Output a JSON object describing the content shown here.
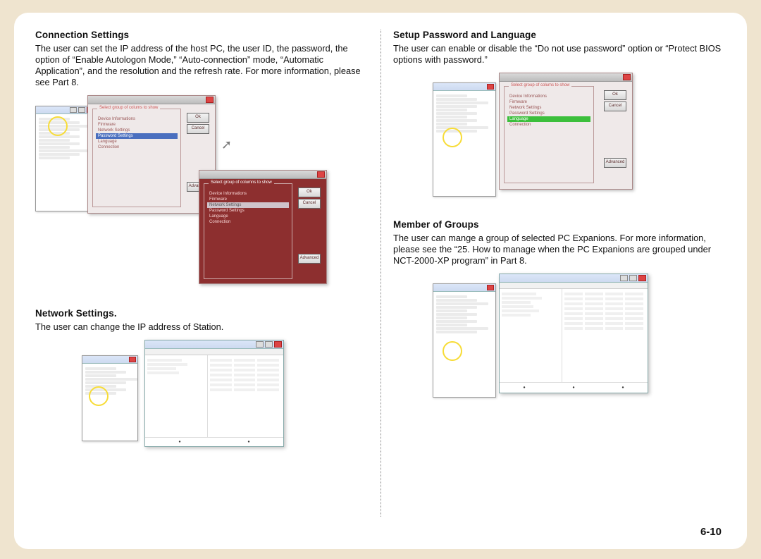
{
  "page_number": "6-10",
  "column_options": [
    "Device Informations",
    "Firmware",
    "Network Settings",
    "Password Settings",
    "Language",
    "Connection"
  ],
  "dialog": {
    "group_label": "Select group of columns to show",
    "group_label_alt": "Select group of colums to show",
    "ok": "Ok",
    "cancel": "Cancel",
    "advanced": "Advanced"
  },
  "sections": {
    "connection": {
      "heading": "Connection Settings",
      "body": "The user can set the IP address of the host PC, the user ID, the password, the option of “Enable Autologon Mode,” “Auto-connection” mode, “Automatic Application”, and the resolution and the refresh rate. For more information, please see Part 8."
    },
    "network": {
      "heading": "Network Settings.",
      "body": "The user can change the IP address of Station."
    },
    "password_lang": {
      "heading": "Setup Password and Language",
      "body": "The user can enable or disable the “Do not use password” option or “Protect BIOS options with password.”"
    },
    "groups": {
      "heading": "Member of Groups",
      "body": "The user can mange a group of selected PC Expanions. For more information, please see the “25. How to manage when the PC Expanions are grouped under NCT-2000-XP program” in Part 8."
    }
  }
}
